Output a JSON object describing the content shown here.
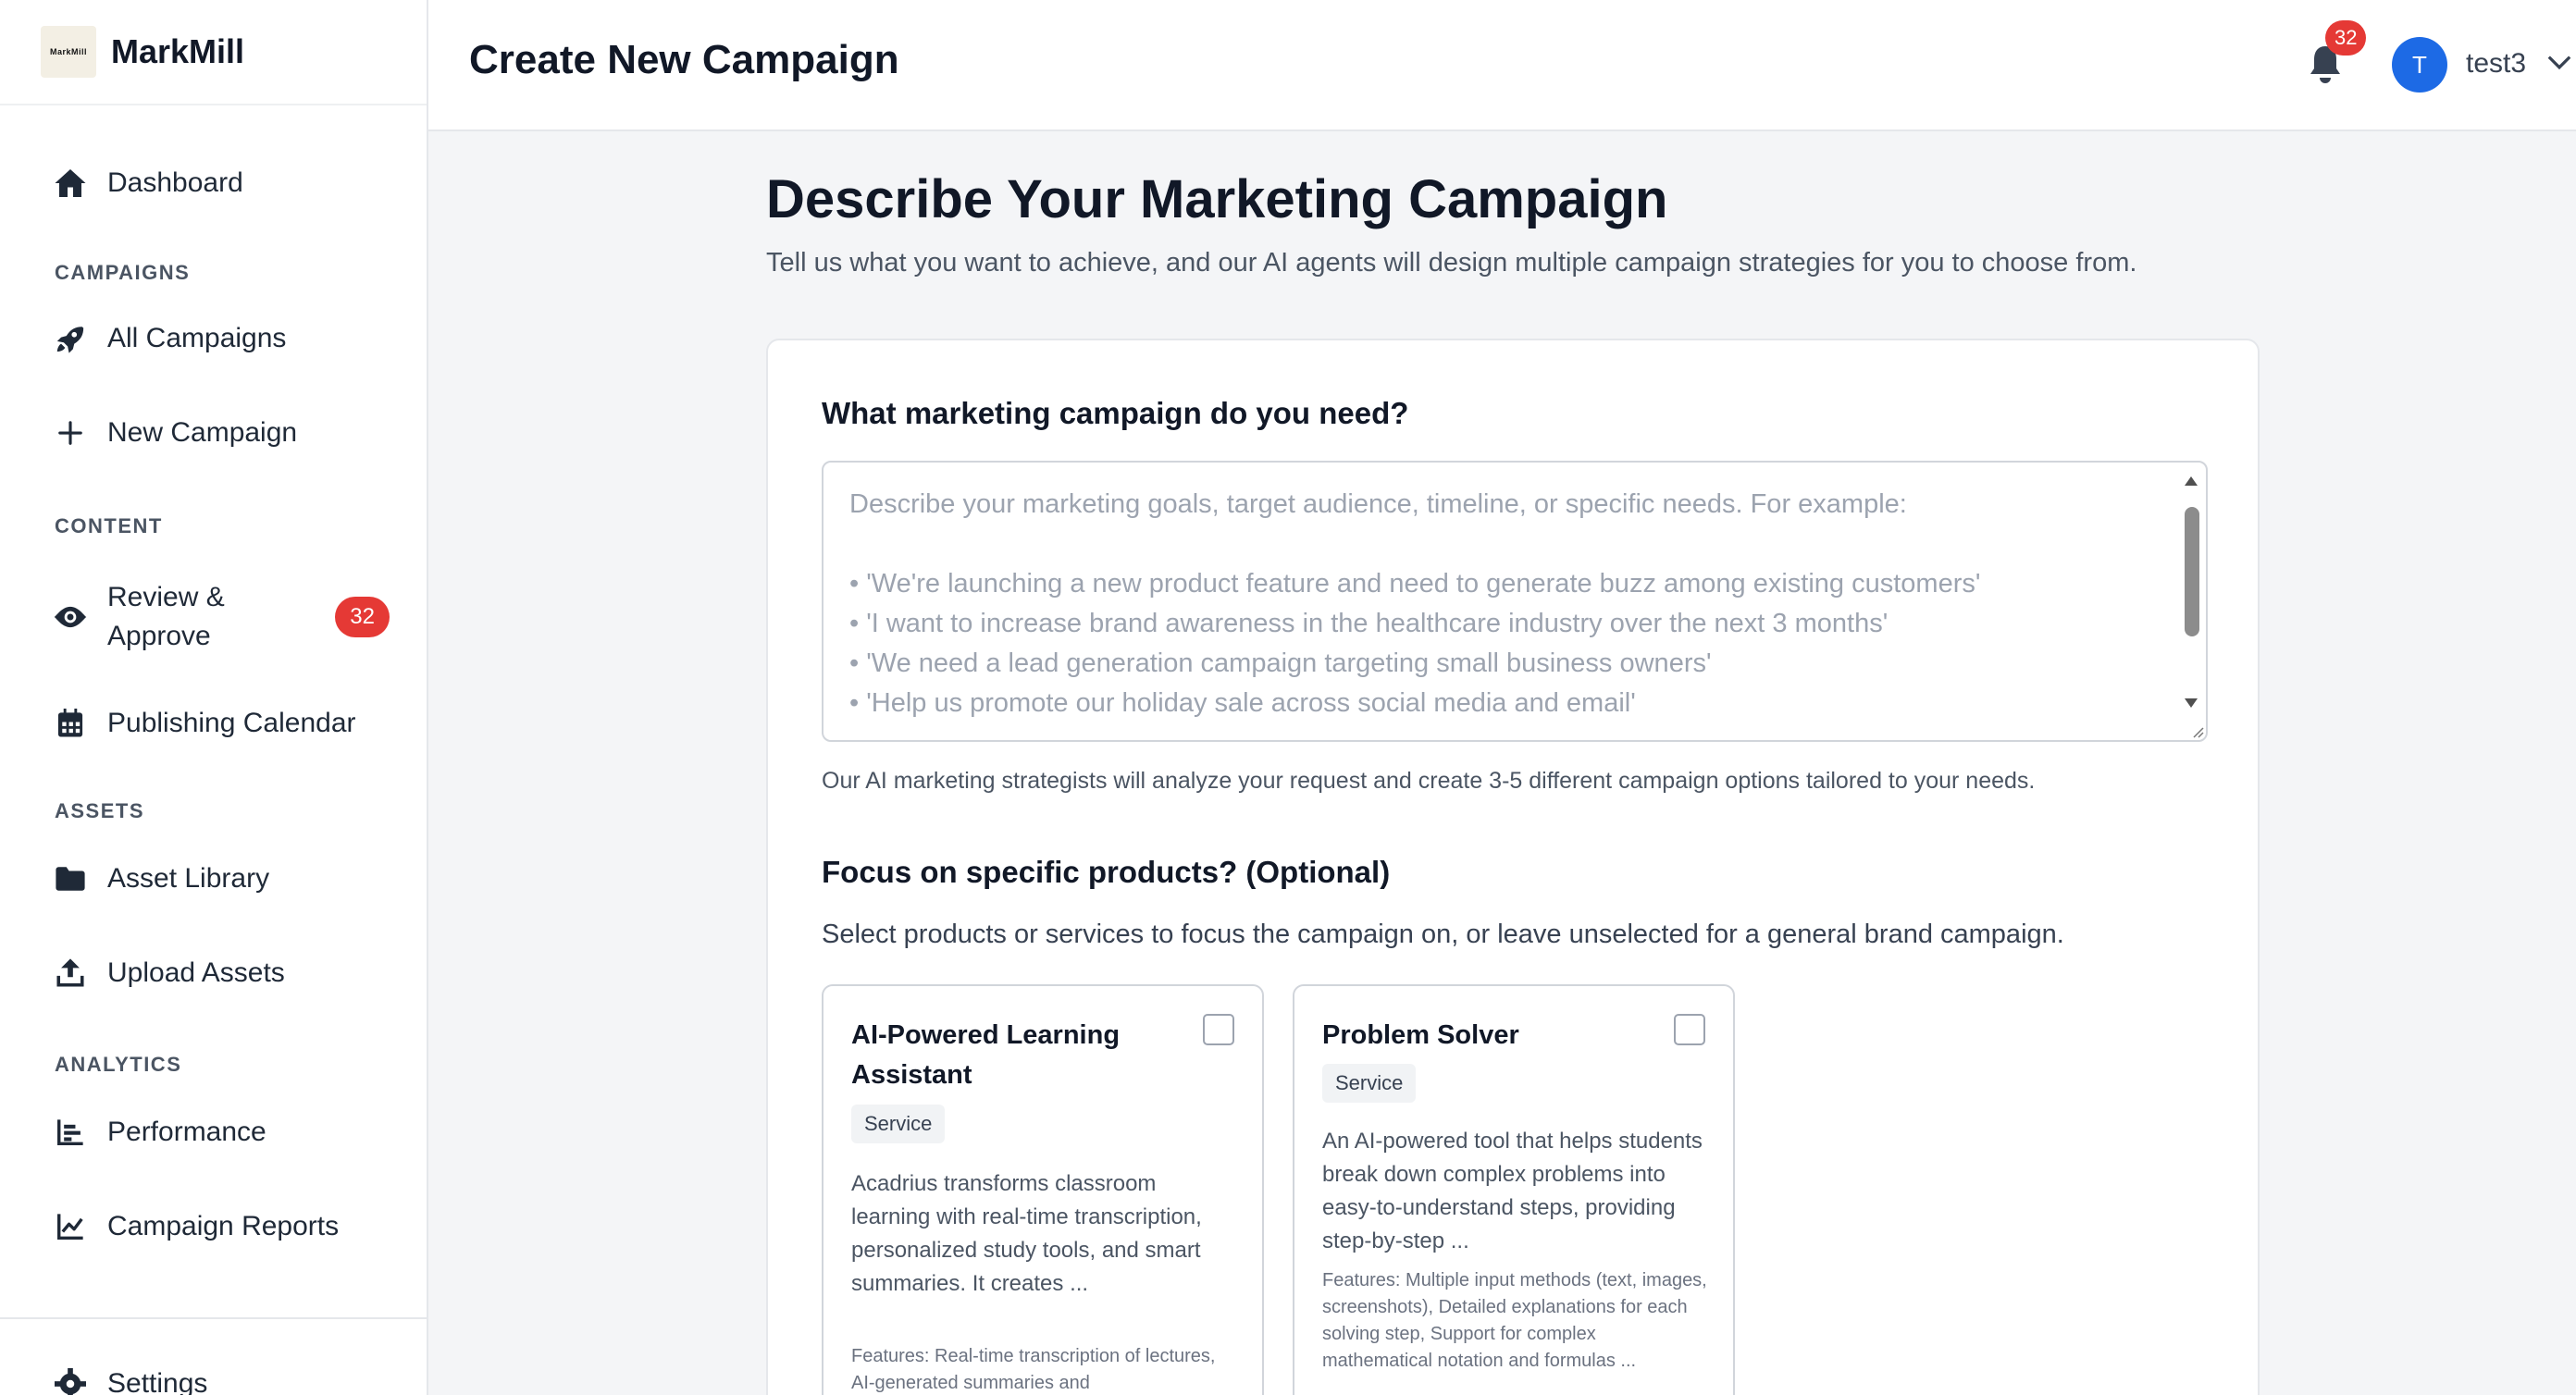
{
  "brand": {
    "name": "MarkMill",
    "logo_text": "MarkMill"
  },
  "sidebar": {
    "dashboard": "Dashboard",
    "sections": {
      "campaigns": "CAMPAIGNS",
      "content": "CONTENT",
      "assets": "ASSETS",
      "analytics": "ANALYTICS"
    },
    "items": {
      "all_campaigns": "All Campaigns",
      "new_campaign": "New Campaign",
      "review_line1": "Review &",
      "review_line2": "Approve",
      "review_badge": "32",
      "publishing_calendar": "Publishing Calendar",
      "asset_library": "Asset Library",
      "upload_assets": "Upload Assets",
      "performance": "Performance",
      "campaign_reports": "Campaign Reports",
      "settings": "Settings"
    }
  },
  "header": {
    "title": "Create New Campaign",
    "notification_count": "32",
    "avatar_initial": "T",
    "username": "test3"
  },
  "main": {
    "title": "Describe Your Marketing Campaign",
    "subtitle": "Tell us what you want to achieve, and our AI agents will design multiple campaign strategies for you to choose from.",
    "question1": "What marketing campaign do you need?",
    "textarea": {
      "value": "",
      "placeholder_lines": [
        "Describe your marketing goals, target audience, timeline, or specific needs. For example:",
        "",
        "• 'We're launching a new product feature and need to generate buzz among existing customers'",
        "• 'I want to increase brand awareness in the healthcare industry over the next 3 months'",
        "• 'We need a lead generation campaign targeting small business owners'",
        "• 'Help us promote our holiday sale across social media and email'"
      ]
    },
    "helper": "Our AI marketing strategists will analyze your request and create 3-5 different campaign options tailored to your needs.",
    "question2": "Focus on specific products? (Optional)",
    "question2_sub": "Select products or services to focus the campaign on, or leave unselected for a general brand campaign.",
    "products": [
      {
        "title": "AI-Powered Learning Assistant",
        "tag": "Service",
        "description": "Acadrius transforms classroom learning with real-time transcription, personalized study tools, and smart summaries. It creates ...",
        "features": "Features: Real-time transcription of lectures, AI-generated summaries and"
      },
      {
        "title": "Problem Solver",
        "tag": "Service",
        "description": "An AI-powered tool that helps students break down complex problems into easy-to-understand steps, providing step-by-step ...",
        "features": "Features: Multiple input methods (text, images, screenshots), Detailed explanations for each solving step, Support for complex mathematical notation and formulas ..."
      }
    ]
  },
  "colors": {
    "accent": "#1d6ae5",
    "badge": "#e53935"
  }
}
